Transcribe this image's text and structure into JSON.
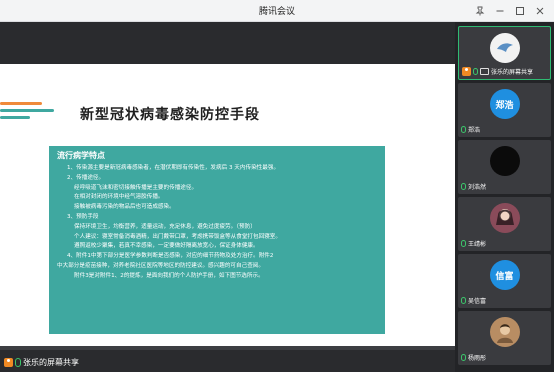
{
  "window": {
    "title": "腾讯会议"
  },
  "slide": {
    "title": "新型冠状病毒感染防控手段",
    "box_heading": "流行病学特点",
    "lines": [
      "1、传染源主要是新冠病毒感染者，在潜伏期即有传染性，发病后 3 天内传染性最强。",
      "2、传播途径。",
      "经呼吸道飞沫和密切接触传播是主要的传播途径。",
      "在相对封闭的环境中经气溶胶传播。",
      "接触被病毒污染的物品后也可造成感染。",
      "3、预防手段",
      "保持环境卫生，均衡营养，适量运动，充足休息，避免过度疲劳。（预防）",
      "个人建议：寝室常备消毒酒精，出门戴带口罩，考虑携带饭盒等从食堂打包回寝室。",
      "遵照返校少聚集，若真不幸感染，一定要做好隔离放宽心，保证身体健康。",
      "4、附件1中第下部分是医学参数判断是否感染，对应的细节药物及处方治疗。附件2",
      "中大部分是疫苗接种，对养老院社区医院等地区的防控建议。感兴趣的可自己查阅。",
      "附件3是对附件1、2的提炼，是面向我们的个人防护手册，如下图节选所示。"
    ]
  },
  "share": {
    "label": "张乐的屏幕共享"
  },
  "participants": [
    {
      "name": "张乐的屏幕共享",
      "avatar_text": "",
      "avatar_color": "#f2f2f2",
      "active": true
    },
    {
      "name": "郑浩",
      "avatar_text": "郑浩",
      "avatar_color": "#1f8fe0",
      "active": false
    },
    {
      "name": "刘浩然",
      "avatar_text": "",
      "avatar_color": "#0b0b0b",
      "active": false
    },
    {
      "name": "王靖彬",
      "avatar_text": "",
      "avatar_color": "#8a4b5a",
      "active": false
    },
    {
      "name": "吴信富",
      "avatar_text": "信富",
      "avatar_color": "#1f8fe0",
      "active": false
    },
    {
      "name": "杨雨彤",
      "avatar_text": "",
      "avatar_color": "#b88d63",
      "active": false
    }
  ]
}
